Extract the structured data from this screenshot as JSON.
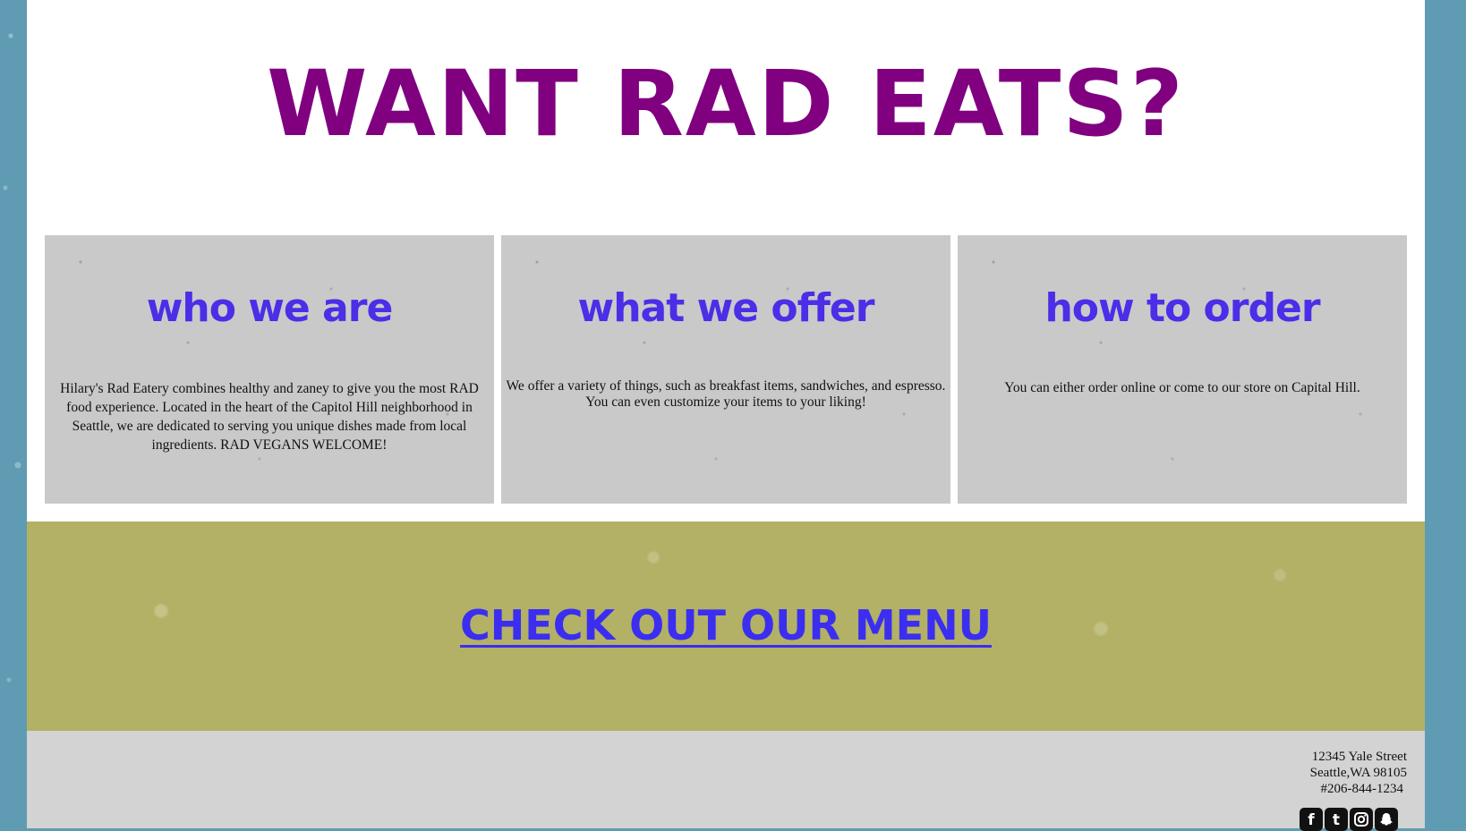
{
  "colors": {
    "headline": "#800080",
    "card_title": "#4a2ee8",
    "menu_link": "#3b2ef0",
    "card_bg": "#c9c9c9",
    "menu_band_bg": "#b2b166",
    "footer_bg": "#d3d3d3",
    "page_bg": "#5f9bb3"
  },
  "hero": {
    "title": "WANT RAD EATS?"
  },
  "cards": [
    {
      "title": "who we are",
      "body": "Hilary's Rad Eatery combines healthy and zaney to give you the most RAD food experience. Located in the heart of the Capitol Hill neighborhood in Seattle, we are dedicated to serving you unique dishes made from local ingredients. RAD VEGANS WELCOME!"
    },
    {
      "title": "what we offer",
      "body": "We offer a variety of things, such as breakfast items, sandwiches, and espresso. You can even customize your items to your liking!"
    },
    {
      "title": "how to order",
      "body": "You can either order online or come to our store on Capital Hill."
    }
  ],
  "menu": {
    "link_label": "CHECK OUT OUR MENU"
  },
  "footer": {
    "address_line1": "12345 Yale Street",
    "address_line2": "Seattle,WA 98105",
    "phone": "#206-844-1234",
    "socials": [
      {
        "icon": "facebook-icon",
        "glyph": "f"
      },
      {
        "icon": "twitter-icon",
        "glyph": "t"
      },
      {
        "icon": "instagram-icon",
        "glyph": ""
      },
      {
        "icon": "snapchat-icon",
        "glyph": ""
      }
    ]
  }
}
